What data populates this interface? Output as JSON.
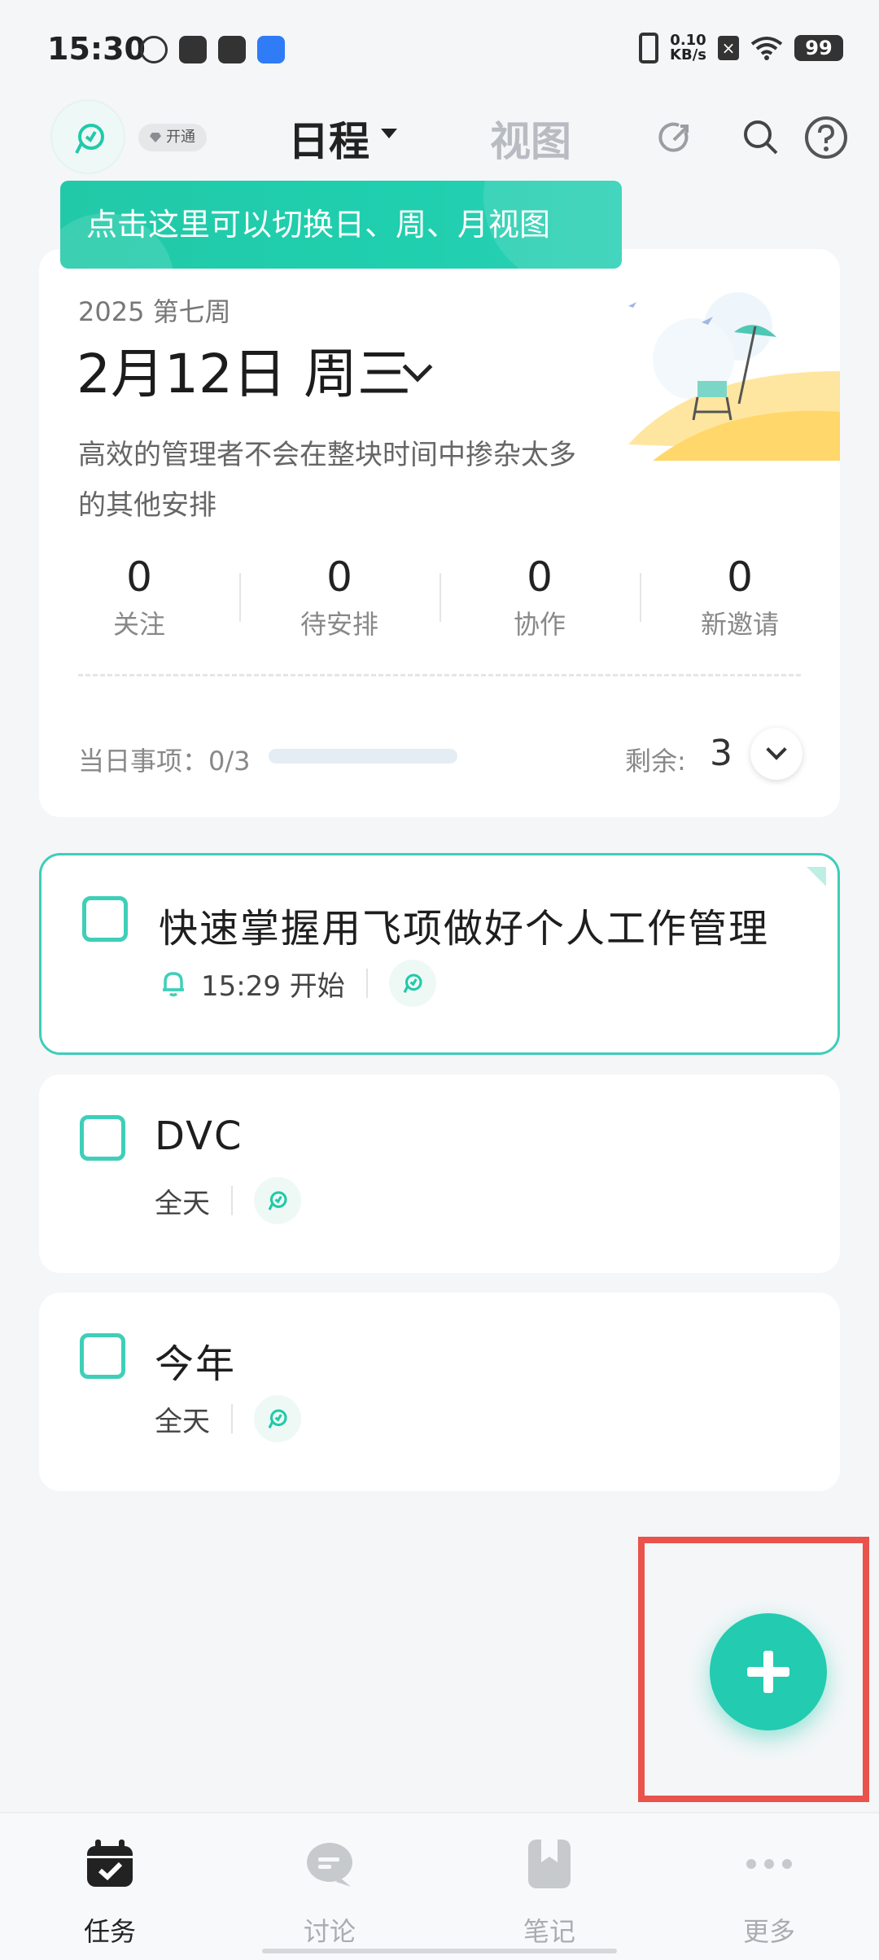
{
  "status_bar": {
    "time": "15:30",
    "net_speed_value": "0.10",
    "net_speed_unit": "KB/s",
    "battery": "99"
  },
  "header": {
    "vip_label": "开通",
    "tab_schedule": "日程",
    "tab_view": "视图"
  },
  "tooltip": {
    "text": "点击这里可以切换日、周、月视图"
  },
  "summary": {
    "week": "2025 第七周",
    "date": "2月12日 周三",
    "quote": "高效的管理者不会在整块时间中掺杂太多的其他安排",
    "stats": [
      {
        "value": "0",
        "label": "关注"
      },
      {
        "value": "0",
        "label": "待安排"
      },
      {
        "value": "0",
        "label": "协作"
      },
      {
        "value": "0",
        "label": "新邀请"
      }
    ],
    "day_items_label": "当日事项：0/3",
    "day_items_progress": 0,
    "remaining_label": "剩余:",
    "remaining_value": "3"
  },
  "tasks": [
    {
      "title": "快速掌握用飞项做好个人工作管理",
      "time": "15:29 开始"
    },
    {
      "title": "DVC",
      "time": "全天"
    },
    {
      "title": "今年",
      "time": "全天"
    }
  ],
  "bottom_nav": [
    {
      "label": "任务",
      "active": true
    },
    {
      "label": "讨论",
      "active": false
    },
    {
      "label": "笔记",
      "active": false
    },
    {
      "label": "更多",
      "active": false
    }
  ],
  "colors": {
    "accent": "#22c9a8",
    "highlight_frame": "#e9534c"
  },
  "icons": {
    "status_left": [
      "qq-icon",
      "link-icon",
      "vivo-icon",
      "edit-icon"
    ],
    "header_right": [
      "share-icon",
      "search-icon",
      "help-icon"
    ]
  }
}
